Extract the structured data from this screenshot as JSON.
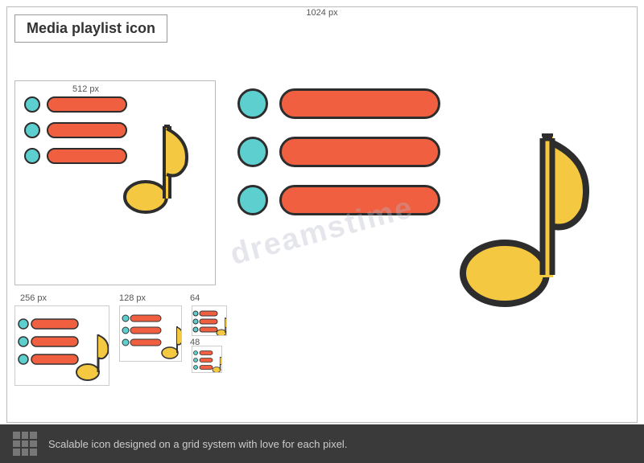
{
  "title": "Media playlist icon",
  "dimensions": {
    "d1024": "1024 px",
    "d512": "512 px",
    "d256": "256 px",
    "d128": "128 px",
    "d64": "64",
    "d48": "48"
  },
  "colors": {
    "bar_fill": "#f06040",
    "bar_stroke": "#2d2d2d",
    "dot_fill": "#5ecfcf",
    "note_fill": "#f5c842",
    "note_stroke": "#2d2d2d",
    "bg": "#ffffff"
  },
  "bottom_bar": {
    "text": "Scalable icon designed on a grid system with love for each pixel."
  },
  "watermark": "dreamstime"
}
